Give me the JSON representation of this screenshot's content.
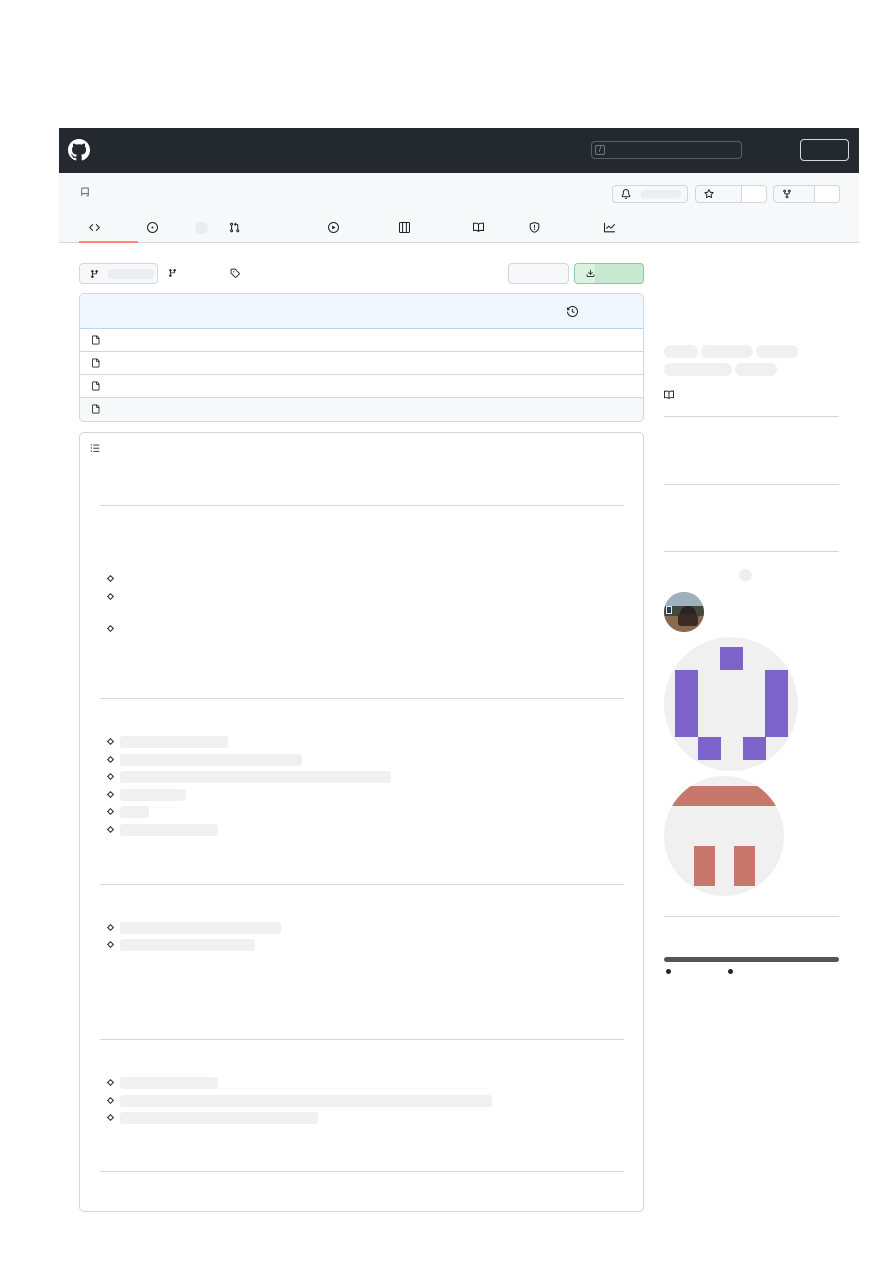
{
  "header": {
    "logo_icon": "github-mark-icon",
    "search_shortcut": "/"
  },
  "repo": {
    "icon": "repo-icon",
    "actions": {
      "notifications_icon": "bell-icon",
      "star_icon": "star-icon",
      "fork_icon": "fork-icon"
    },
    "tabs": [
      {
        "icon": "code-icon",
        "active": true
      },
      {
        "icon": "issue-opened-icon"
      },
      {
        "icon": "git-pull-request-icon"
      },
      {
        "icon": "play-icon"
      },
      {
        "icon": "table-icon"
      },
      {
        "icon": "book-icon"
      },
      {
        "icon": "shield-icon"
      },
      {
        "icon": "graph-icon"
      }
    ]
  },
  "colors": {
    "header_bg": "#24292f",
    "active_tab_underline": "#fd8c73",
    "code_button": "#c6e9cf",
    "identicon_purple": "#7c63c9",
    "identicon_salmon": "#c8786a"
  }
}
